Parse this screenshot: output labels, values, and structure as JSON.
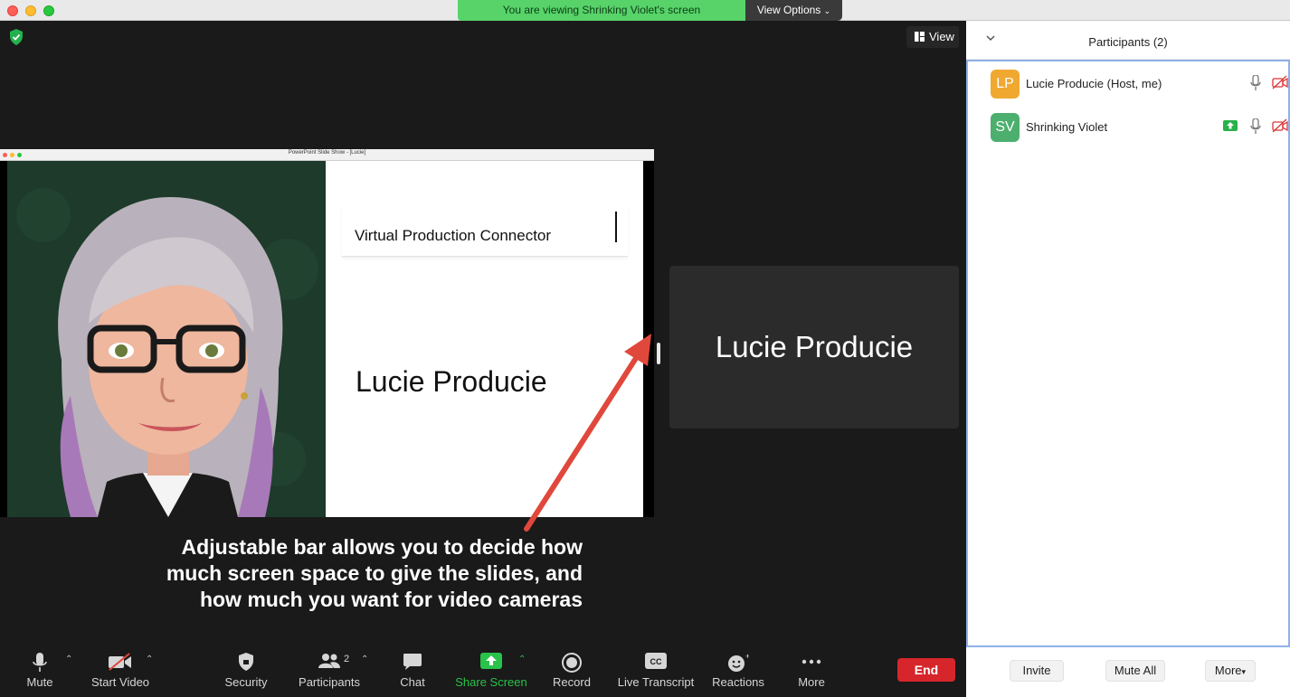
{
  "window": {
    "viewing_banner": "You are viewing Shrinking Violet's screen",
    "view_options_label": "View Options"
  },
  "main": {
    "view_button_label": "View",
    "shared_screen": {
      "window_title": "PowerPoint Slide Show - [Lucie]",
      "slide_title": "Virtual Production Connector",
      "slide_name": "Lucie Producie"
    },
    "video_tile_name": "Lucie Producie",
    "caption_lines": [
      "Adjustable bar allows you to decide how",
      "much screen space to give the slides, and",
      "how much you want for video cameras"
    ]
  },
  "toolbar": {
    "mute": "Mute",
    "start_video": "Start Video",
    "security": "Security",
    "participants": "Participants",
    "participants_count": "2",
    "chat": "Chat",
    "share_screen": "Share Screen",
    "record": "Record",
    "live_transcript": "Live Transcript",
    "reactions": "Reactions",
    "more": "More",
    "end": "End"
  },
  "participants_panel": {
    "title": "Participants (2)",
    "participants": [
      {
        "initials": "LP",
        "name": "Lucie Producie (Host, me)",
        "color": "#f0a830"
      },
      {
        "initials": "SV",
        "name": "Shrinking Violet",
        "color": "#4caf6e"
      }
    ],
    "footer": {
      "invite": "Invite",
      "mute_all": "Mute All",
      "more": "More"
    }
  },
  "colors": {
    "share_green": "#29c24a",
    "end_red": "#d7262b",
    "arrow_red": "#e0483c"
  }
}
